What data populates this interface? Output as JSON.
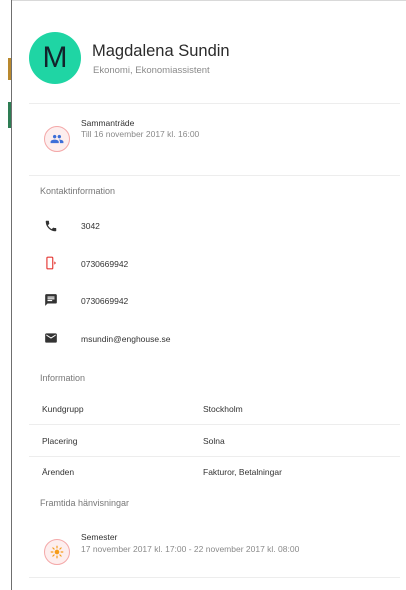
{
  "profile": {
    "avatar_initial": "M",
    "name": "Magdalena Sundin",
    "role": "Ekonomi, Ekonomiassistent"
  },
  "status": {
    "title": "Sammanträde",
    "subtitle": "Till 16 november 2017 kl. 16:00",
    "icon": "people-icon"
  },
  "contact": {
    "title": "Kontaktinformation",
    "items": [
      {
        "icon": "phone-icon",
        "value": "3042"
      },
      {
        "icon": "mobile-icon",
        "value": "0730669942"
      },
      {
        "icon": "message-icon",
        "value": "0730669942"
      },
      {
        "icon": "email-icon",
        "value": "msundin@enghouse.se"
      }
    ]
  },
  "information": {
    "title": "Information",
    "rows": [
      {
        "label": "Kundgrupp",
        "value": "Stockholm"
      },
      {
        "label": "Placering",
        "value": "Solna"
      },
      {
        "label": "Ärenden",
        "value": "Fakturor, Betalningar"
      }
    ]
  },
  "future": {
    "title": "Framtida hänvisningar",
    "items": [
      {
        "title": "Semester",
        "subtitle": "17 november 2017 kl. 17:00 - 22 november 2017 kl. 08:00",
        "icon": "sun-icon"
      }
    ]
  },
  "colors": {
    "avatar_bg": "#1fd5a4",
    "accent_blue": "#3d6fd8",
    "alert_red": "#e53935",
    "sun_orange": "#f59c1a",
    "ring_border": "#f4a8a8",
    "ring_bg": "#fdeeee"
  }
}
